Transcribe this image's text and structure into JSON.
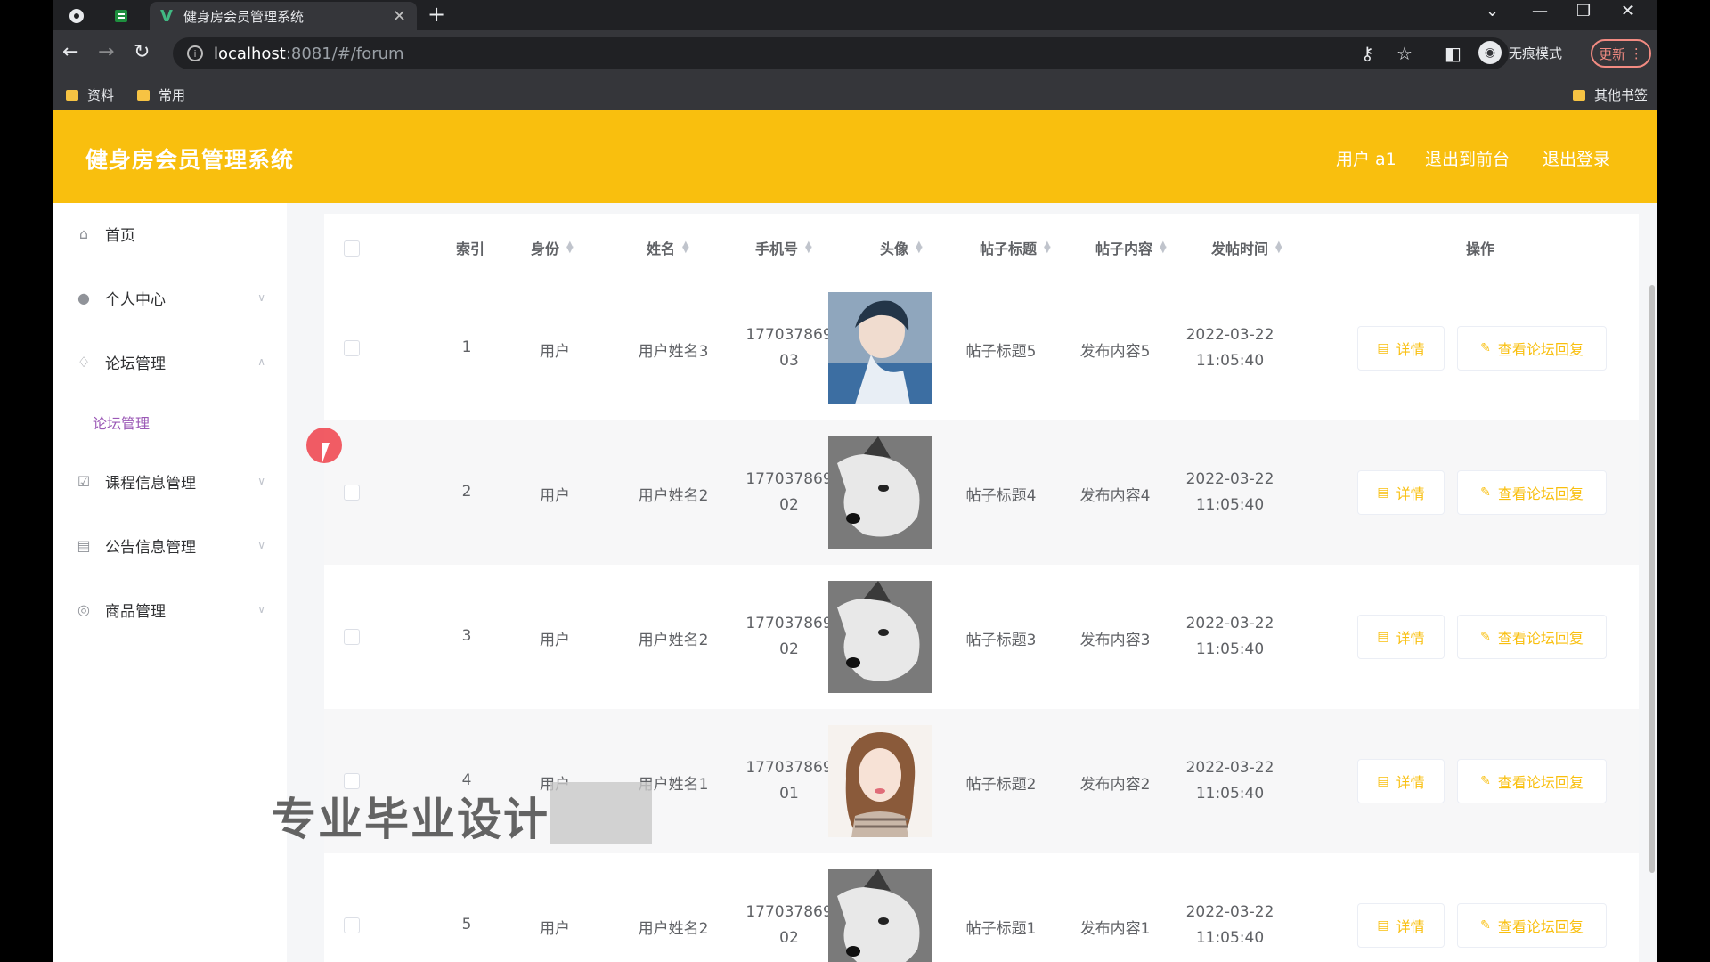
{
  "browser": {
    "tab_title": "健身房会员管理系统",
    "url_host": "localhost",
    "url_path": ":8081/#/forum",
    "incognito_label": "无痕模式",
    "update_label": "更新",
    "bookmarks": [
      "资料",
      "常用"
    ],
    "other_bookmarks": "其他书签"
  },
  "app": {
    "title": "健身房会员管理系统",
    "user_label": "用户 a1",
    "back_to_front": "退出到前台",
    "logout": "退出登录"
  },
  "sidebar": {
    "items": [
      {
        "label": "首页",
        "icon": "home-icon"
      },
      {
        "label": "个人中心",
        "icon": "user-icon"
      },
      {
        "label": "论坛管理",
        "icon": "bell-icon"
      },
      {
        "label": "课程信息管理",
        "icon": "checkbox-icon"
      },
      {
        "label": "公告信息管理",
        "icon": "clipboard-icon"
      },
      {
        "label": "商品管理",
        "icon": "settings-icon"
      }
    ],
    "submenu_active": "论坛管理"
  },
  "table": {
    "columns": [
      "索引",
      "身份",
      "姓名",
      "手机号",
      "头像",
      "帖子标题",
      "帖子内容",
      "发帖时间",
      "操作"
    ],
    "rows": [
      {
        "index": "1",
        "role": "用户",
        "name": "用户姓名3",
        "phone1": "177037869",
        "phone2": "03",
        "title": "帖子标题5",
        "content": "发布内容5",
        "date": "2022-03-22",
        "time": "11:05:40"
      },
      {
        "index": "2",
        "role": "用户",
        "name": "用户姓名2",
        "phone1": "177037869",
        "phone2": "02",
        "title": "帖子标题4",
        "content": "发布内容4",
        "date": "2022-03-22",
        "time": "11:05:40"
      },
      {
        "index": "3",
        "role": "用户",
        "name": "用户姓名2",
        "phone1": "177037869",
        "phone2": "02",
        "title": "帖子标题3",
        "content": "发布内容3",
        "date": "2022-03-22",
        "time": "11:05:40"
      },
      {
        "index": "4",
        "role": "用户",
        "name": "用户姓名1",
        "phone1": "177037869",
        "phone2": "01",
        "title": "帖子标题2",
        "content": "发布内容2",
        "date": "2022-03-22",
        "time": "11:05:40"
      },
      {
        "index": "5",
        "role": "用户",
        "name": "用户姓名2",
        "phone1": "177037869",
        "phone2": "02",
        "title": "帖子标题1",
        "content": "发布内容1",
        "date": "2022-03-22",
        "time": "11:05:40"
      }
    ],
    "detail_label": "详情",
    "reply_label": "查看论坛回复"
  },
  "overlay": {
    "watermark": "专业毕业设计"
  },
  "colors": {
    "accent": "#f9bf0e",
    "submenu_active": "#9b59b6"
  }
}
